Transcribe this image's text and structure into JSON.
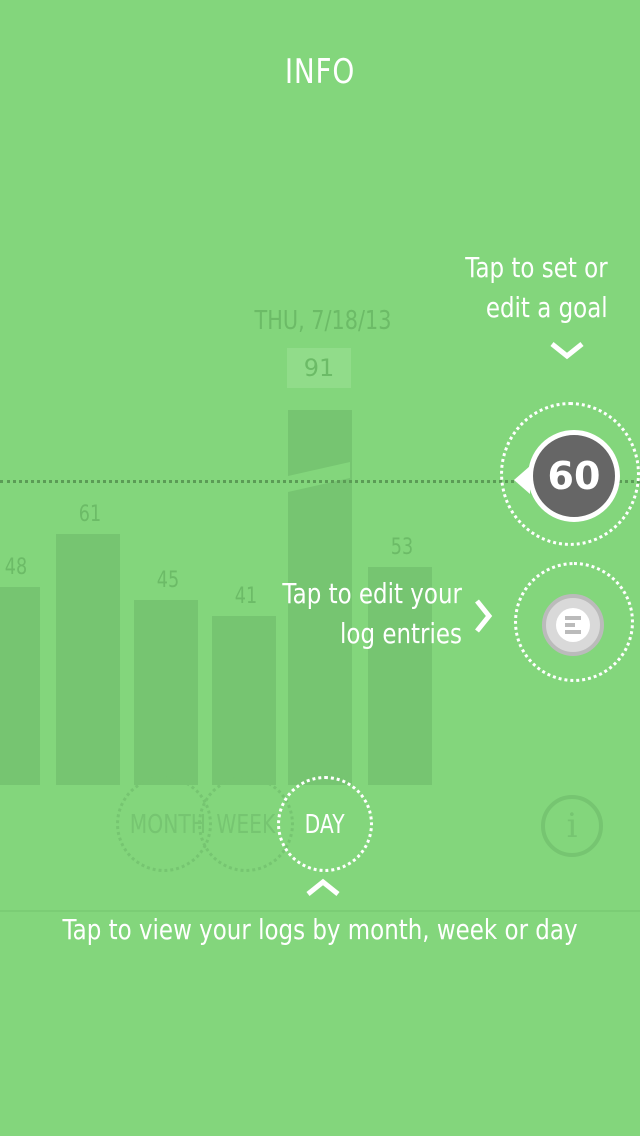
{
  "header": {
    "title": "INFO"
  },
  "chart_data": {
    "type": "bar",
    "selected_date": "THU, 7/18/13",
    "selected_value": 91,
    "values": [
      48,
      61,
      45,
      41,
      91,
      53
    ],
    "goal": 60,
    "ylim": [
      0,
      91
    ]
  },
  "goal": {
    "value": "60"
  },
  "hints": {
    "goal_line1": "Tap to set or",
    "goal_line2": "edit a goal",
    "log_line1": "Tap to edit your",
    "log_line2": "log entries",
    "view": "Tap to view your logs by month, week or day"
  },
  "view_modes": {
    "month": "MONTH",
    "week": "WEEK",
    "day": "DAY",
    "selected": "DAY"
  },
  "colors": {
    "background": "#83d67c",
    "bar": "#76c571",
    "goal_badge": "#666666",
    "text": "#ffffff"
  },
  "icons": {
    "goal_chevron": "chevron-down-icon",
    "log_chevron": "chevron-right-icon",
    "view_chevron": "chevron-up-icon",
    "log": "log-entries-icon",
    "info": "info-icon"
  },
  "info_button": {
    "glyph": "i"
  }
}
